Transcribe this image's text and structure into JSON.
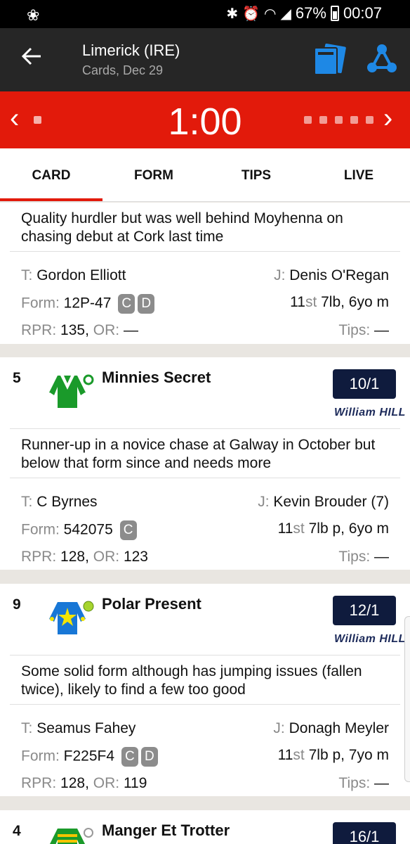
{
  "status_bar": {
    "battery": "67%",
    "time": "00:07",
    "icons": [
      "app-notification-icon",
      "bluetooth-icon",
      "alarm-icon",
      "wifi-icon",
      "signal-icon",
      "battery-icon"
    ]
  },
  "app_bar": {
    "title": "Limerick (IRE)",
    "subtitle": "Cards, Dec 29",
    "accent_color": "#1e88e5"
  },
  "race_nav": {
    "time": "1:00",
    "prev_symbol": "‹",
    "next_symbol": "›",
    "background": "#e21a0b"
  },
  "tabs": [
    {
      "label": "CARD",
      "active": true
    },
    {
      "label": "FORM",
      "active": false
    },
    {
      "label": "TIPS",
      "active": false
    },
    {
      "label": "LIVE",
      "active": false
    }
  ],
  "runners": [
    {
      "comment": "Quality hurdler but was well behind Moyhenna on chasing debut at Cork last time",
      "trainer_label": "T:",
      "trainer": "Gordon Elliott",
      "jockey_label": "J:",
      "jockey": "Denis O'Regan",
      "form_label": "Form:",
      "form": "12P-47",
      "badges": [
        "C",
        "D"
      ],
      "weight_st": "11",
      "weight_st_unit": "st",
      "weight_rest": " 7lb, 6yo m",
      "rpr_label": "RPR:",
      "rpr": "135,",
      "or_label": "OR:",
      "or": "—",
      "tips_label": "Tips:",
      "tips": "—"
    },
    {
      "number": "5",
      "name": "Minnies Secret",
      "odds": "10/1",
      "bookmaker": "William HILL",
      "silk": "green-white-silk",
      "comment": "Runner-up in a novice chase at Galway in October but below that form since and needs more",
      "trainer_label": "T:",
      "trainer": "C Byrnes",
      "jockey_label": "J:",
      "jockey": "Kevin Brouder (7)",
      "form_label": "Form:",
      "form": "542075",
      "badges": [
        "C"
      ],
      "weight_st": "11",
      "weight_st_unit": "st",
      "weight_rest": " 7lb p, 6yo m",
      "rpr_label": "RPR:",
      "rpr": "128,",
      "or_label": "OR:",
      "or": "123",
      "tips_label": "Tips:",
      "tips": "—"
    },
    {
      "number": "9",
      "name": "Polar Present",
      "odds": "12/1",
      "bookmaker": "William HILL",
      "silk": "blue-yellow-star-silk",
      "comment": "Some solid form although has jumping issues (fallen twice), likely to find a few too good",
      "trainer_label": "T:",
      "trainer": "Seamus Fahey",
      "jockey_label": "J:",
      "jockey": "Donagh Meyler",
      "form_label": "Form:",
      "form": "F225F4",
      "badges": [
        "C",
        "D"
      ],
      "weight_st": "11",
      "weight_st_unit": "st",
      "weight_rest": " 7lb p, 7yo m",
      "rpr_label": "RPR:",
      "rpr": "128,",
      "or_label": "OR:",
      "or": "119",
      "tips_label": "Tips:",
      "tips": "—"
    },
    {
      "number": "4",
      "name": "Manger Et Trotter",
      "odds": "16/1",
      "silk": "green-yellow-silk"
    }
  ]
}
